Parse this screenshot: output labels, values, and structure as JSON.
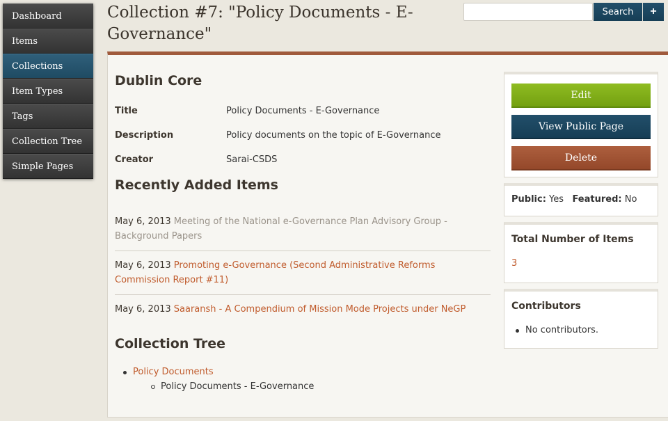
{
  "nav": {
    "items": [
      {
        "label": "Dashboard"
      },
      {
        "label": "Items"
      },
      {
        "label": "Collections"
      },
      {
        "label": "Item Types"
      },
      {
        "label": "Tags"
      },
      {
        "label": "Collection Tree"
      },
      {
        "label": "Simple Pages"
      }
    ],
    "active": "Collections"
  },
  "page": {
    "title": "Collection #7: \"Policy Documents - E-Governance\""
  },
  "search": {
    "placeholder": "",
    "value": "",
    "button_label": "Search",
    "advanced_label": "+"
  },
  "dublin_core": {
    "heading": "Dublin Core",
    "rows": [
      {
        "label": "Title",
        "value": "Policy Documents - E-Governance"
      },
      {
        "label": "Description",
        "value": "Policy documents on the topic of E-Governance"
      },
      {
        "label": "Creator",
        "value": "Sarai-CSDS"
      }
    ]
  },
  "recent": {
    "heading": "Recently Added Items",
    "items": [
      {
        "date": "May 6, 2013",
        "title": "Meeting of the National e-Governance Plan Advisory Group - Background Papers",
        "style": "muted"
      },
      {
        "date": "May 6, 2013",
        "title": "Promoting e-Governance (Second Administrative Reforms Commission Report #11)",
        "style": "orange"
      },
      {
        "date": "May 6, 2013",
        "title": "Saaransh - A Compendium of Mission Mode Projects under NeGP",
        "style": "orange"
      }
    ]
  },
  "tree": {
    "heading": "Collection Tree",
    "parent": "Policy Documents",
    "child": "Policy Documents - E-Governance"
  },
  "actions": {
    "edit_label": "Edit",
    "view_public_label": "View Public Page",
    "delete_label": "Delete"
  },
  "status": {
    "public_label": "Public:",
    "public_value": "Yes",
    "featured_label": "Featured:",
    "featured_value": "No"
  },
  "total": {
    "heading": "Total Number of Items",
    "count": "3"
  },
  "contributors": {
    "heading": "Contributors",
    "empty_text": "No contributors."
  },
  "colors": {
    "accent": "#a05a3c",
    "link": "#c05b2c",
    "nav_active": "#2f5f7a",
    "edit": "#7fae17",
    "primary": "#1c4862",
    "danger": "#a0533a"
  }
}
